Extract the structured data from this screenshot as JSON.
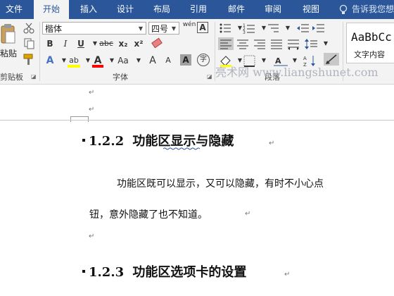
{
  "tabs": {
    "file": "文件",
    "home": "开始",
    "insert": "插入",
    "design": "设计",
    "layout": "布局",
    "references": "引用",
    "mailings": "邮件",
    "review": "审阅",
    "view": "视图"
  },
  "tell_me": "告诉我您想",
  "ribbon": {
    "paste_label": "粘贴",
    "clipboard_label": "剪贴板",
    "font_name": "楷体",
    "font_size": "四号",
    "font_group_label": "字体",
    "paragraph_group_label": "段落",
    "style_preview": "AaBbCc",
    "style_name": "文字内容",
    "buttons": {
      "bold": "B",
      "italic": "I",
      "underline": "U",
      "strikethrough": "abc",
      "subscript": "x₂",
      "superscript": "x²",
      "text_effects": "A",
      "highlight": "ab",
      "font_color": "A",
      "change_case": "Aa",
      "grow_font": "A",
      "shrink_font": "A",
      "char_shading": "A",
      "enclose_char": "字",
      "phonetic": "wén",
      "char_border": "A"
    }
  },
  "watermark": "亮术网 www.liangshunet.com",
  "document": {
    "heading1_number": "1.2.2",
    "heading1_text": "功能区显示与隐藏",
    "para_line1": "功能区既可以显示，又可以隐藏，有时不小心点",
    "para_line2": "钮，意外隐藏了也不知道。",
    "heading2_number": "1.2.3",
    "heading2_text": "功能区选项卡的设置"
  },
  "colors": {
    "ribbon_blue": "#2b579a",
    "ribbon_bg": "#f3f3f3",
    "highlight_yellow": "#ffff00",
    "font_red": "#ff0000"
  }
}
